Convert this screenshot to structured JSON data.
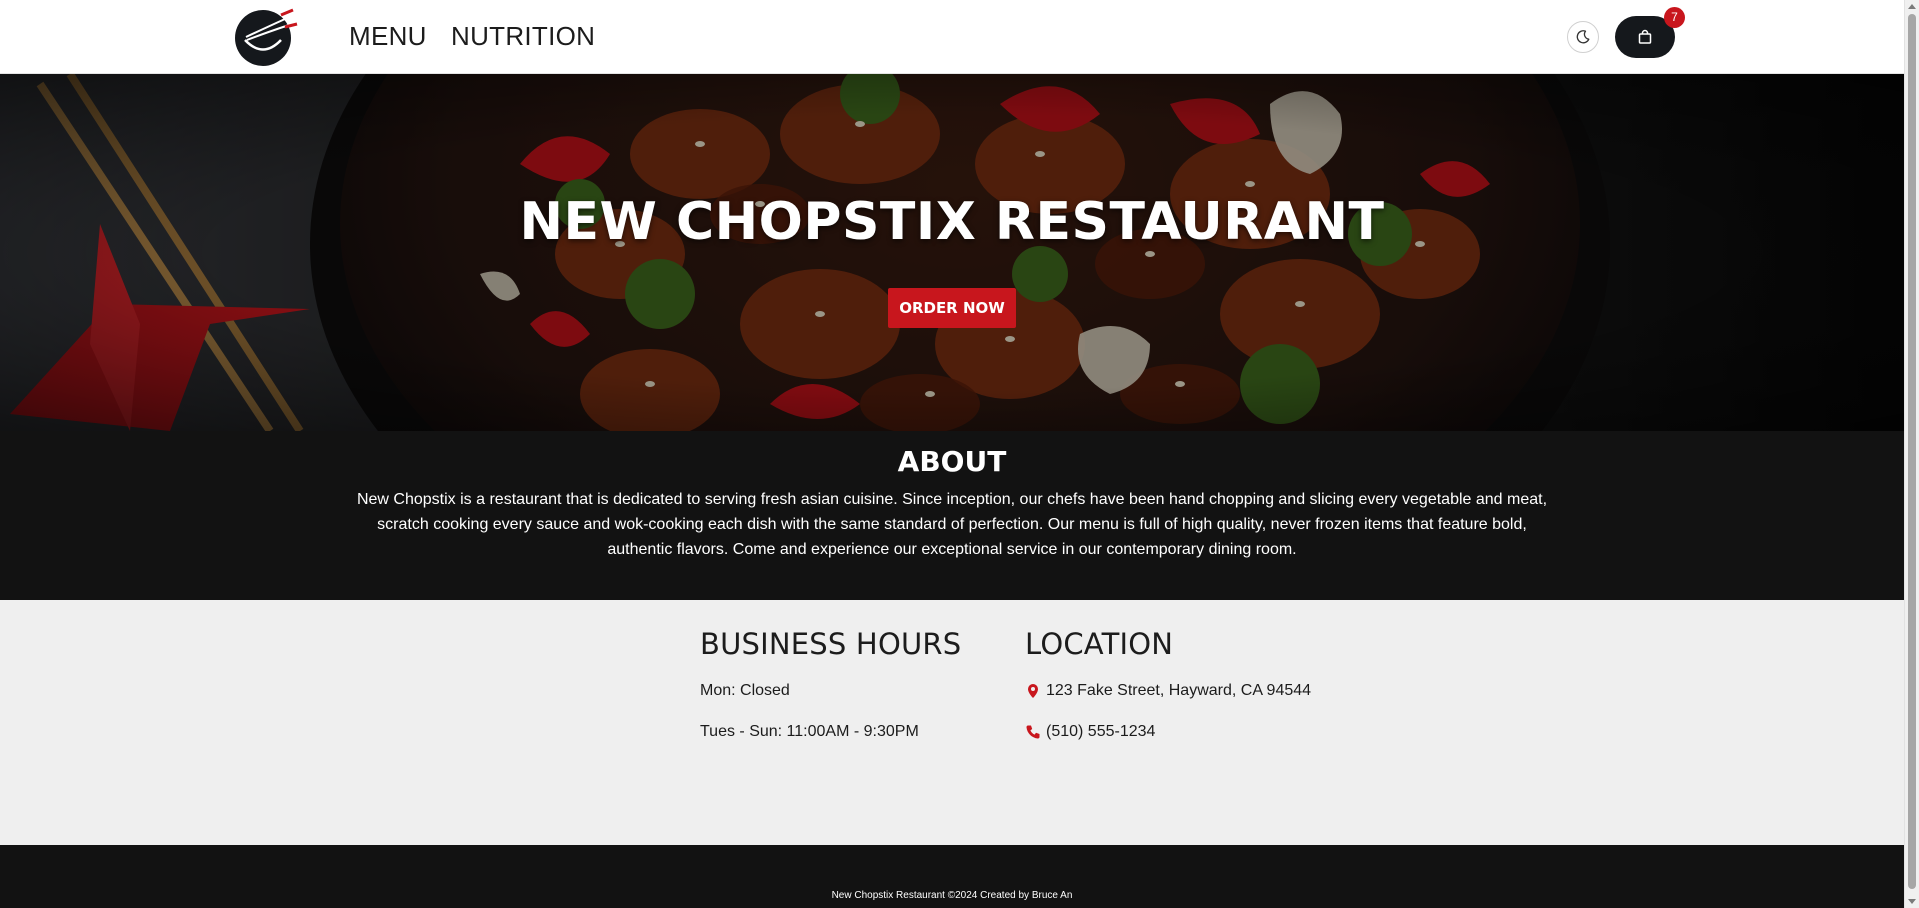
{
  "header": {
    "logo_icon": "chopstix-bowl-logo-icon",
    "nav": [
      {
        "label": "MENU"
      },
      {
        "label": "NUTRITION"
      }
    ],
    "theme_toggle_icon": "moon-icon",
    "cart_icon": "shopping-bag-icon",
    "cart_count": "7"
  },
  "hero": {
    "title": "NEW CHOPSTIX RESTAURANT",
    "cta_label": "ORDER NOW",
    "image": "stir-fry-with-chopsticks"
  },
  "about": {
    "title": "ABOUT",
    "text": "New Chopstix is a restaurant that is dedicated to serving fresh asian cuisine. Since inception, our chefs have been hand chopping and slicing every vegetable and meat, scratch cooking every sauce and wok-cooking each dish with the same standard of perfection. Our menu is full of high quality, never frozen items that feature bold, authentic flavors. Come and experience our exceptional service in our contemporary dining room."
  },
  "hours": {
    "title": "BUSINESS HOURS",
    "lines": [
      "Mon: Closed",
      "Tues - Sun: 11:00AM - 9:30PM"
    ]
  },
  "location": {
    "title": "LOCATION",
    "address": "123 Fake Street, Hayward, CA 94544",
    "address_icon": "map-pin-icon",
    "phone": "(510) 555-1234",
    "phone_icon": "phone-icon"
  },
  "footer": {
    "text": "New Chopstix Restaurant ©2024 Created by Bruce An"
  },
  "colors": {
    "accent": "#c8161d",
    "dark": "#121212",
    "light_section": "#efefef",
    "header_bg": "#ffffff"
  }
}
